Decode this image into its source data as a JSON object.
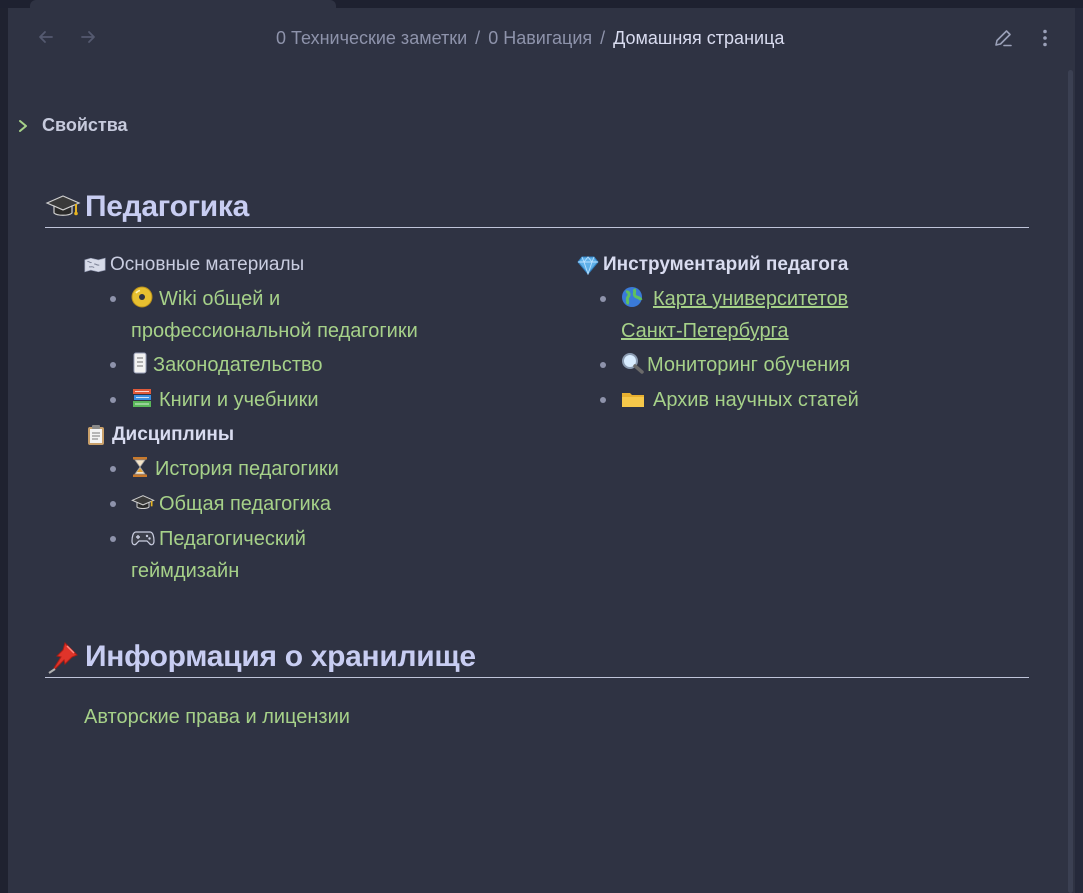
{
  "nav": {
    "back_icon": "arrow-left-icon",
    "forward_icon": "arrow-right-icon",
    "breadcrumb": [
      "0 Технические заметки",
      "0 Навигация",
      "Домашняя страница"
    ],
    "separator": "/",
    "edit_icon": "pencil-icon",
    "more_icon": "more-vertical-icon"
  },
  "properties": {
    "label": "Свойства",
    "icon": "chevron-right-icon"
  },
  "section_pedagogy": {
    "title": "Педагогика",
    "icon": "graduation-cap-icon",
    "left": {
      "group1": {
        "title": "Основные материалы",
        "icon": "world-map-icon",
        "items": [
          {
            "line1": "Wiki общей и",
            "line2": "профессиональной педагогики",
            "icon": "disc-icon"
          },
          {
            "label": "Законодательство",
            "icon": "scroll-icon"
          },
          {
            "label": "Книги и учебники",
            "icon": "books-icon"
          }
        ]
      },
      "group2": {
        "title": "Дисциплины",
        "icon": "clipboard-icon",
        "items": [
          {
            "label": "История педагогики",
            "icon": "hourglass-icon"
          },
          {
            "label": "Общая педагогика",
            "icon": "graduation-cap-icon"
          },
          {
            "line1": "Педагогический",
            "line2": "геймдизайн",
            "icon": "gamepad-icon"
          }
        ]
      }
    },
    "right": {
      "title": "Инструментарий педагога",
      "icon": "gem-icon",
      "items": [
        {
          "line1": "Карта университетов",
          "line2": "Санкт-Петербурга",
          "icon": "globe-icon"
        },
        {
          "label": "Мониторинг обучения",
          "icon": "magnifier-icon"
        },
        {
          "label": "Архив научных статей",
          "icon": "folder-icon"
        }
      ]
    }
  },
  "section_storage": {
    "title": "Информация о хранилище",
    "icon": "pushpin-icon",
    "link": "Авторские права и лицензии"
  },
  "colors": {
    "background": "#2f3343",
    "link": "#a6d189",
    "heading": "#c8cdf2",
    "muted": "#8e93ab"
  }
}
